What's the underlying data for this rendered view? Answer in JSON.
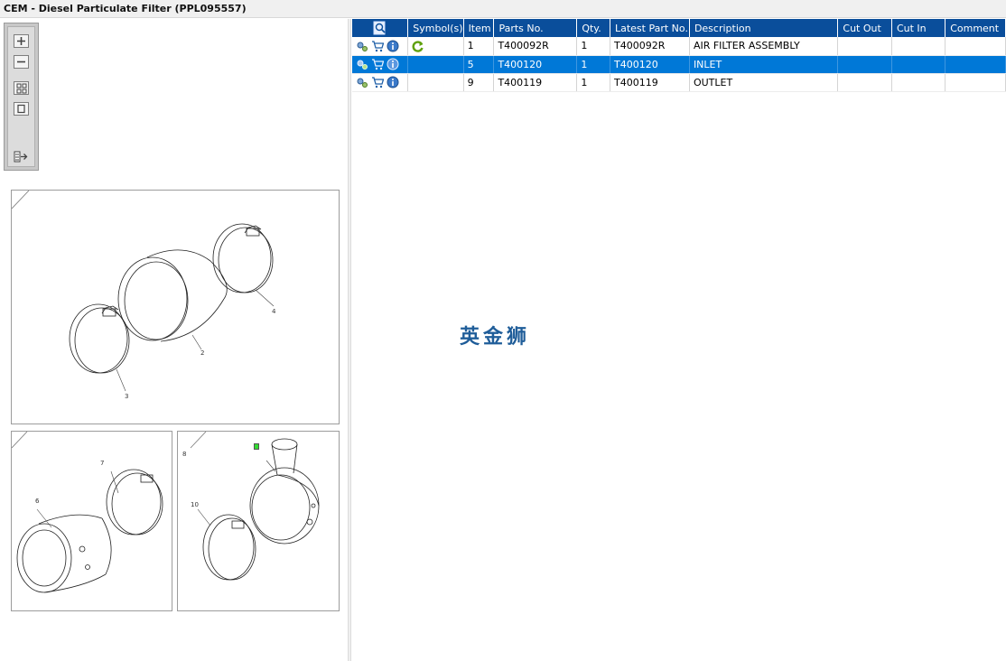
{
  "window": {
    "title": "CEM - Diesel Particulate Filter (PPL095557)"
  },
  "toolbox": {
    "buttons": [
      {
        "name": "zoom-in",
        "icon": "plus-icon"
      },
      {
        "name": "zoom-out",
        "icon": "minus-icon"
      },
      {
        "name": "show-all",
        "icon": "grid-four-icon"
      },
      {
        "name": "show-single",
        "icon": "single-frame-icon"
      },
      {
        "name": "export",
        "icon": "list-arrow-icon"
      }
    ]
  },
  "illustration": {
    "frames": [
      {
        "marker": "green",
        "callouts": [
          "4",
          "2",
          "3"
        ]
      },
      {
        "marker": "red",
        "callouts": [
          "7",
          "6"
        ]
      },
      {
        "marker": "green",
        "callouts": [
          "8",
          "10"
        ]
      }
    ]
  },
  "table": {
    "columns": [
      "",
      "Symbol(s)",
      "Item",
      "Parts No.",
      "Qty.",
      "Latest Part No.",
      "Description",
      "Cut Out",
      "Cut In",
      "Comment"
    ],
    "rows": [
      {
        "item": "1",
        "parts_no": "T400092R",
        "qty": "1",
        "latest": "T400092R",
        "description": "AIR FILTER ASSEMBLY",
        "cut_out": "",
        "cut_in": "",
        "comment": "",
        "symbol": "refresh-icon",
        "selected": false
      },
      {
        "item": "5",
        "parts_no": "T400120",
        "qty": "1",
        "latest": "T400120",
        "description": "INLET",
        "cut_out": "",
        "cut_in": "",
        "comment": "",
        "symbol": "",
        "selected": true
      },
      {
        "item": "9",
        "parts_no": "T400119",
        "qty": "1",
        "latest": "T400119",
        "description": "OUTLET",
        "cut_out": "",
        "cut_in": "",
        "comment": "",
        "symbol": "",
        "selected": false
      }
    ],
    "row_icons": [
      "gears-icon",
      "cart-icon",
      "info-icon"
    ]
  },
  "watermark": {
    "text": "英金狮"
  },
  "colors": {
    "header_bg": "#0a4e9b",
    "selected_row": "#0078d7",
    "watermark": "#1f5d99",
    "marker_green": "#33dd33",
    "marker_red": "#ee7777"
  }
}
